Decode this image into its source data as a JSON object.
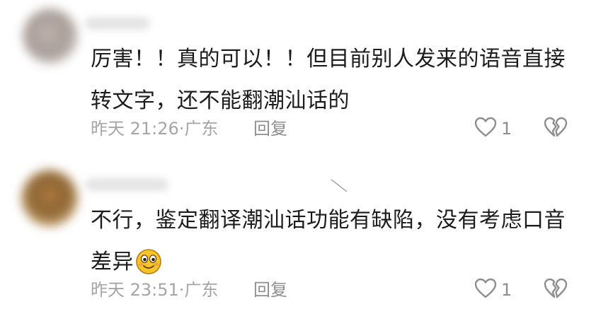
{
  "comments": [
    {
      "text_lines": [
        "厉害！！真的可以！！但目前别人发来的语音直接",
        "转文字，还不能翻潮汕话的"
      ],
      "time": "昨天 21:26",
      "location_sep": "·",
      "location": "广东",
      "reply_label": "回复",
      "like_count": "1",
      "icons": [
        "avatar",
        "heart-icon",
        "broken-heart-icon"
      ]
    },
    {
      "text_lines": [
        "不行，鉴定翻译潮汕话功能有缺陷，没有考虑口音",
        "差异"
      ],
      "emoji": "smiling-face-emoji",
      "time": "昨天 23:51",
      "location_sep": "·",
      "location": "广东",
      "reply_label": "回复",
      "like_count": "1",
      "icons": [
        "avatar",
        "heart-icon",
        "broken-heart-icon"
      ]
    }
  ],
  "colors": {
    "text": "#1c1c1c",
    "meta": "#a5a5a5",
    "action": "#8e8e8e",
    "background": "#ffffff"
  }
}
